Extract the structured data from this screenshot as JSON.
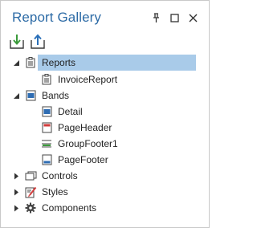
{
  "panel": {
    "title": "Report Gallery",
    "accent": "#2d6ba6",
    "selection_color": "#a9cbe9"
  },
  "window_buttons": [
    {
      "name": "pin-icon",
      "label": ""
    },
    {
      "name": "maximize-icon",
      "label": ""
    },
    {
      "name": "close-icon",
      "label": ""
    }
  ],
  "toolbar": {
    "import_icon": "import-icon",
    "export_icon": "export-icon"
  },
  "tree": {
    "reports": {
      "label": "Reports",
      "expanded": true,
      "selected": true,
      "icon": "report-icon"
    },
    "invoice_report": {
      "label": "InvoiceReport",
      "icon": "report-icon"
    },
    "bands": {
      "label": "Bands",
      "expanded": true,
      "icon": "bands-icon"
    },
    "detail": {
      "label": "Detail",
      "icon": "detail-band-icon"
    },
    "page_header": {
      "label": "PageHeader",
      "icon": "page-header-band-icon"
    },
    "group_footer": {
      "label": "GroupFooter1",
      "icon": "group-footer-band-icon"
    },
    "page_footer": {
      "label": "PageFooter",
      "icon": "page-footer-band-icon"
    },
    "controls": {
      "label": "Controls",
      "expanded": false,
      "icon": "controls-icon"
    },
    "styles": {
      "label": "Styles",
      "expanded": false,
      "icon": "styles-icon"
    },
    "components": {
      "label": "Components",
      "expanded": false,
      "icon": "gear-icon"
    }
  }
}
